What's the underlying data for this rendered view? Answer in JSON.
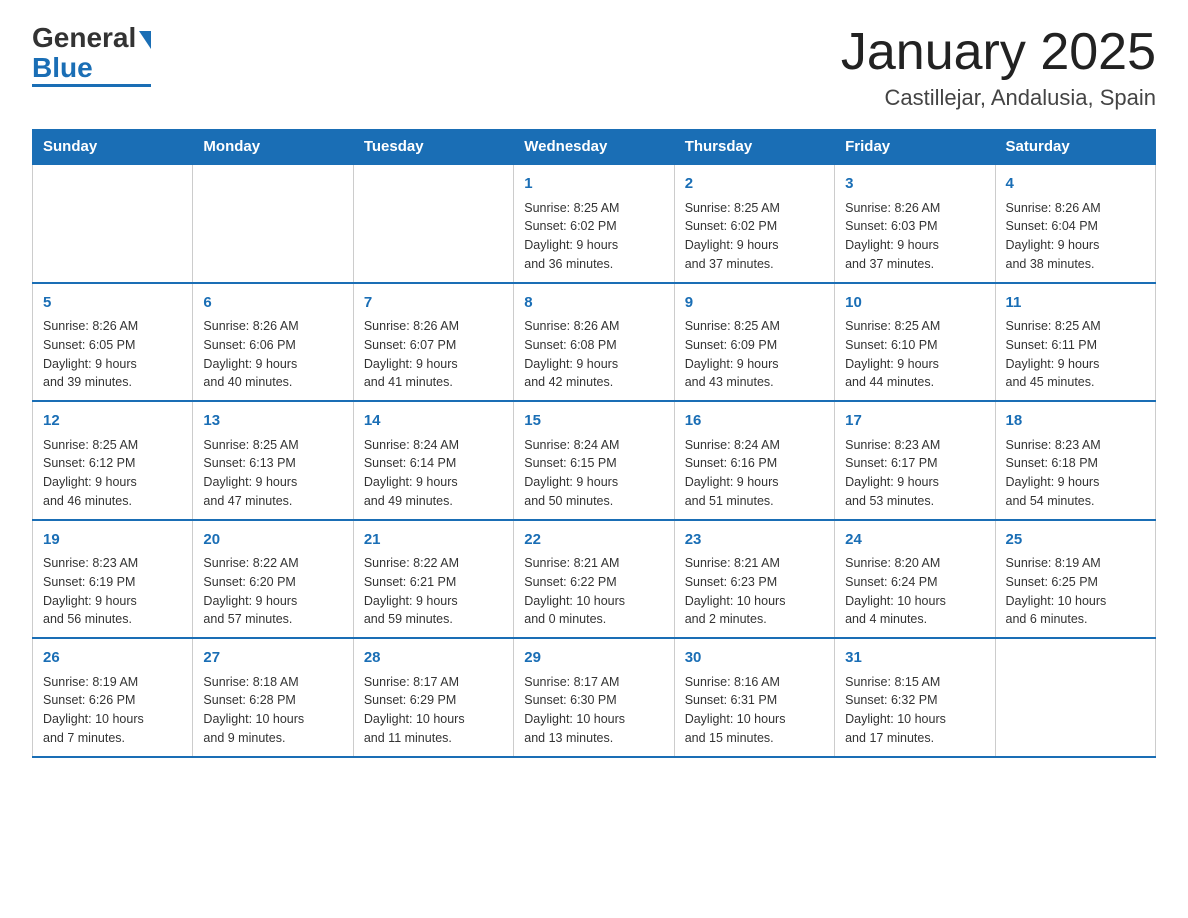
{
  "header": {
    "logo_general": "General",
    "logo_blue": "Blue",
    "month_title": "January 2025",
    "location": "Castillejar, Andalusia, Spain"
  },
  "columns": [
    "Sunday",
    "Monday",
    "Tuesday",
    "Wednesday",
    "Thursday",
    "Friday",
    "Saturday"
  ],
  "weeks": [
    [
      {
        "day": "",
        "info": ""
      },
      {
        "day": "",
        "info": ""
      },
      {
        "day": "",
        "info": ""
      },
      {
        "day": "1",
        "info": "Sunrise: 8:25 AM\nSunset: 6:02 PM\nDaylight: 9 hours\nand 36 minutes."
      },
      {
        "day": "2",
        "info": "Sunrise: 8:25 AM\nSunset: 6:02 PM\nDaylight: 9 hours\nand 37 minutes."
      },
      {
        "day": "3",
        "info": "Sunrise: 8:26 AM\nSunset: 6:03 PM\nDaylight: 9 hours\nand 37 minutes."
      },
      {
        "day": "4",
        "info": "Sunrise: 8:26 AM\nSunset: 6:04 PM\nDaylight: 9 hours\nand 38 minutes."
      }
    ],
    [
      {
        "day": "5",
        "info": "Sunrise: 8:26 AM\nSunset: 6:05 PM\nDaylight: 9 hours\nand 39 minutes."
      },
      {
        "day": "6",
        "info": "Sunrise: 8:26 AM\nSunset: 6:06 PM\nDaylight: 9 hours\nand 40 minutes."
      },
      {
        "day": "7",
        "info": "Sunrise: 8:26 AM\nSunset: 6:07 PM\nDaylight: 9 hours\nand 41 minutes."
      },
      {
        "day": "8",
        "info": "Sunrise: 8:26 AM\nSunset: 6:08 PM\nDaylight: 9 hours\nand 42 minutes."
      },
      {
        "day": "9",
        "info": "Sunrise: 8:25 AM\nSunset: 6:09 PM\nDaylight: 9 hours\nand 43 minutes."
      },
      {
        "day": "10",
        "info": "Sunrise: 8:25 AM\nSunset: 6:10 PM\nDaylight: 9 hours\nand 44 minutes."
      },
      {
        "day": "11",
        "info": "Sunrise: 8:25 AM\nSunset: 6:11 PM\nDaylight: 9 hours\nand 45 minutes."
      }
    ],
    [
      {
        "day": "12",
        "info": "Sunrise: 8:25 AM\nSunset: 6:12 PM\nDaylight: 9 hours\nand 46 minutes."
      },
      {
        "day": "13",
        "info": "Sunrise: 8:25 AM\nSunset: 6:13 PM\nDaylight: 9 hours\nand 47 minutes."
      },
      {
        "day": "14",
        "info": "Sunrise: 8:24 AM\nSunset: 6:14 PM\nDaylight: 9 hours\nand 49 minutes."
      },
      {
        "day": "15",
        "info": "Sunrise: 8:24 AM\nSunset: 6:15 PM\nDaylight: 9 hours\nand 50 minutes."
      },
      {
        "day": "16",
        "info": "Sunrise: 8:24 AM\nSunset: 6:16 PM\nDaylight: 9 hours\nand 51 minutes."
      },
      {
        "day": "17",
        "info": "Sunrise: 8:23 AM\nSunset: 6:17 PM\nDaylight: 9 hours\nand 53 minutes."
      },
      {
        "day": "18",
        "info": "Sunrise: 8:23 AM\nSunset: 6:18 PM\nDaylight: 9 hours\nand 54 minutes."
      }
    ],
    [
      {
        "day": "19",
        "info": "Sunrise: 8:23 AM\nSunset: 6:19 PM\nDaylight: 9 hours\nand 56 minutes."
      },
      {
        "day": "20",
        "info": "Sunrise: 8:22 AM\nSunset: 6:20 PM\nDaylight: 9 hours\nand 57 minutes."
      },
      {
        "day": "21",
        "info": "Sunrise: 8:22 AM\nSunset: 6:21 PM\nDaylight: 9 hours\nand 59 minutes."
      },
      {
        "day": "22",
        "info": "Sunrise: 8:21 AM\nSunset: 6:22 PM\nDaylight: 10 hours\nand 0 minutes."
      },
      {
        "day": "23",
        "info": "Sunrise: 8:21 AM\nSunset: 6:23 PM\nDaylight: 10 hours\nand 2 minutes."
      },
      {
        "day": "24",
        "info": "Sunrise: 8:20 AM\nSunset: 6:24 PM\nDaylight: 10 hours\nand 4 minutes."
      },
      {
        "day": "25",
        "info": "Sunrise: 8:19 AM\nSunset: 6:25 PM\nDaylight: 10 hours\nand 6 minutes."
      }
    ],
    [
      {
        "day": "26",
        "info": "Sunrise: 8:19 AM\nSunset: 6:26 PM\nDaylight: 10 hours\nand 7 minutes."
      },
      {
        "day": "27",
        "info": "Sunrise: 8:18 AM\nSunset: 6:28 PM\nDaylight: 10 hours\nand 9 minutes."
      },
      {
        "day": "28",
        "info": "Sunrise: 8:17 AM\nSunset: 6:29 PM\nDaylight: 10 hours\nand 11 minutes."
      },
      {
        "day": "29",
        "info": "Sunrise: 8:17 AM\nSunset: 6:30 PM\nDaylight: 10 hours\nand 13 minutes."
      },
      {
        "day": "30",
        "info": "Sunrise: 8:16 AM\nSunset: 6:31 PM\nDaylight: 10 hours\nand 15 minutes."
      },
      {
        "day": "31",
        "info": "Sunrise: 8:15 AM\nSunset: 6:32 PM\nDaylight: 10 hours\nand 17 minutes."
      },
      {
        "day": "",
        "info": ""
      }
    ]
  ]
}
